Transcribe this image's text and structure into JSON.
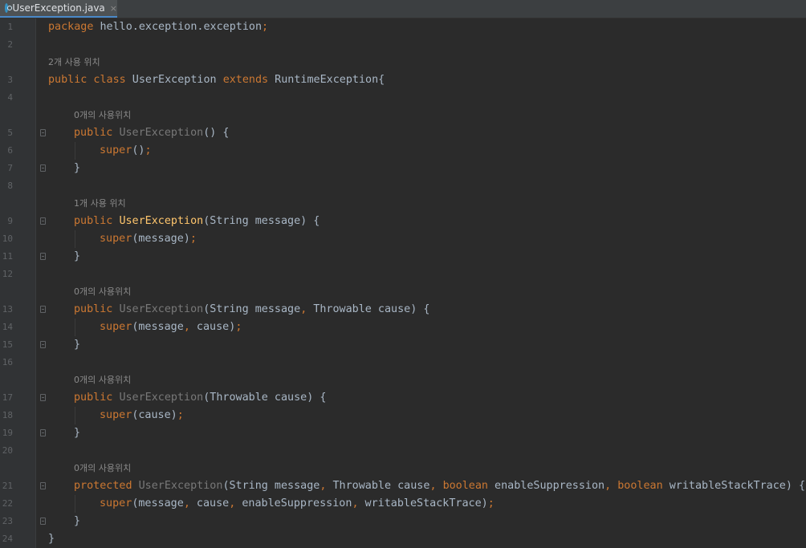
{
  "tab": {
    "label": "UserException.java",
    "close": "×"
  },
  "lines": [
    {
      "n": "1",
      "tokens": [
        {
          "t": "package",
          "c": "kw"
        },
        {
          "t": " hello.exception.exception"
        },
        {
          "t": ";",
          "c": "kw"
        }
      ]
    },
    {
      "n": "2",
      "tokens": []
    },
    {
      "hint": "2개 사용 위치",
      "indent": 0
    },
    {
      "n": "3",
      "tokens": [
        {
          "t": "public class",
          "c": "kw"
        },
        {
          "t": " UserException "
        },
        {
          "t": "extends",
          "c": "kw"
        },
        {
          "t": " RuntimeException{"
        }
      ]
    },
    {
      "n": "4",
      "tokens": []
    },
    {
      "hint": "0개의 사용위치",
      "indent": 1
    },
    {
      "n": "5",
      "indent": 1,
      "fold": "open",
      "tokens": [
        {
          "t": "public",
          "c": "kw"
        },
        {
          "t": " "
        },
        {
          "t": "UserException",
          "c": "unused"
        },
        {
          "t": "() {"
        }
      ]
    },
    {
      "n": "6",
      "indent": 2,
      "tokens": [
        {
          "t": "super",
          "c": "kw"
        },
        {
          "t": "()"
        },
        {
          "t": ";",
          "c": "kw"
        }
      ]
    },
    {
      "n": "7",
      "indent": 1,
      "fold": "close",
      "tokens": [
        {
          "t": "}"
        }
      ]
    },
    {
      "n": "8",
      "tokens": []
    },
    {
      "hint": "1개 사용 위치",
      "indent": 1
    },
    {
      "n": "9",
      "indent": 1,
      "fold": "open",
      "tokens": [
        {
          "t": "public",
          "c": "kw"
        },
        {
          "t": " "
        },
        {
          "t": "UserException",
          "c": "fn"
        },
        {
          "t": "(String message) {"
        }
      ]
    },
    {
      "n": "10",
      "indent": 2,
      "tokens": [
        {
          "t": "super",
          "c": "kw"
        },
        {
          "t": "(message)"
        },
        {
          "t": ";",
          "c": "kw"
        }
      ]
    },
    {
      "n": "11",
      "indent": 1,
      "fold": "close",
      "tokens": [
        {
          "t": "}"
        }
      ]
    },
    {
      "n": "12",
      "tokens": []
    },
    {
      "hint": "0개의 사용위치",
      "indent": 1
    },
    {
      "n": "13",
      "indent": 1,
      "fold": "open",
      "tokens": [
        {
          "t": "public",
          "c": "kw"
        },
        {
          "t": " "
        },
        {
          "t": "UserException",
          "c": "unused"
        },
        {
          "t": "(String message"
        },
        {
          "t": ",",
          "c": "kw"
        },
        {
          "t": " Throwable cause) {"
        }
      ]
    },
    {
      "n": "14",
      "indent": 2,
      "tokens": [
        {
          "t": "super",
          "c": "kw"
        },
        {
          "t": "(message"
        },
        {
          "t": ",",
          "c": "kw"
        },
        {
          "t": " cause)"
        },
        {
          "t": ";",
          "c": "kw"
        }
      ]
    },
    {
      "n": "15",
      "indent": 1,
      "fold": "close",
      "tokens": [
        {
          "t": "}"
        }
      ]
    },
    {
      "n": "16",
      "tokens": []
    },
    {
      "hint": "0개의 사용위치",
      "indent": 1
    },
    {
      "n": "17",
      "indent": 1,
      "fold": "open",
      "tokens": [
        {
          "t": "public",
          "c": "kw"
        },
        {
          "t": " "
        },
        {
          "t": "UserException",
          "c": "unused"
        },
        {
          "t": "(Throwable cause) {"
        }
      ]
    },
    {
      "n": "18",
      "indent": 2,
      "tokens": [
        {
          "t": "super",
          "c": "kw"
        },
        {
          "t": "(cause)"
        },
        {
          "t": ";",
          "c": "kw"
        }
      ]
    },
    {
      "n": "19",
      "indent": 1,
      "fold": "close",
      "tokens": [
        {
          "t": "}"
        }
      ]
    },
    {
      "n": "20",
      "tokens": []
    },
    {
      "hint": "0개의 사용위치",
      "indent": 1
    },
    {
      "n": "21",
      "indent": 1,
      "fold": "open",
      "tokens": [
        {
          "t": "protected",
          "c": "kw"
        },
        {
          "t": " "
        },
        {
          "t": "UserException",
          "c": "unused"
        },
        {
          "t": "(String message"
        },
        {
          "t": ",",
          "c": "kw"
        },
        {
          "t": " Throwable cause"
        },
        {
          "t": ",",
          "c": "kw"
        },
        {
          "t": " "
        },
        {
          "t": "boolean",
          "c": "kw"
        },
        {
          "t": " enableSuppression"
        },
        {
          "t": ",",
          "c": "kw"
        },
        {
          "t": " "
        },
        {
          "t": "boolean",
          "c": "kw"
        },
        {
          "t": " writableStackTrace) {"
        }
      ]
    },
    {
      "n": "22",
      "indent": 2,
      "tokens": [
        {
          "t": "super",
          "c": "kw"
        },
        {
          "t": "(message"
        },
        {
          "t": ",",
          "c": "kw"
        },
        {
          "t": " cause"
        },
        {
          "t": ",",
          "c": "kw"
        },
        {
          "t": " enableSuppression"
        },
        {
          "t": ",",
          "c": "kw"
        },
        {
          "t": " writableStackTrace)"
        },
        {
          "t": ";",
          "c": "kw"
        }
      ]
    },
    {
      "n": "23",
      "indent": 1,
      "fold": "close",
      "tokens": [
        {
          "t": "}"
        }
      ]
    },
    {
      "n": "24",
      "tokens": [
        {
          "t": "}"
        }
      ]
    }
  ],
  "colors": {
    "keyword": "#cc7832",
    "method": "#ffc66d",
    "text": "#a9b7c6",
    "unused": "#787878",
    "background": "#2b2b2b"
  }
}
